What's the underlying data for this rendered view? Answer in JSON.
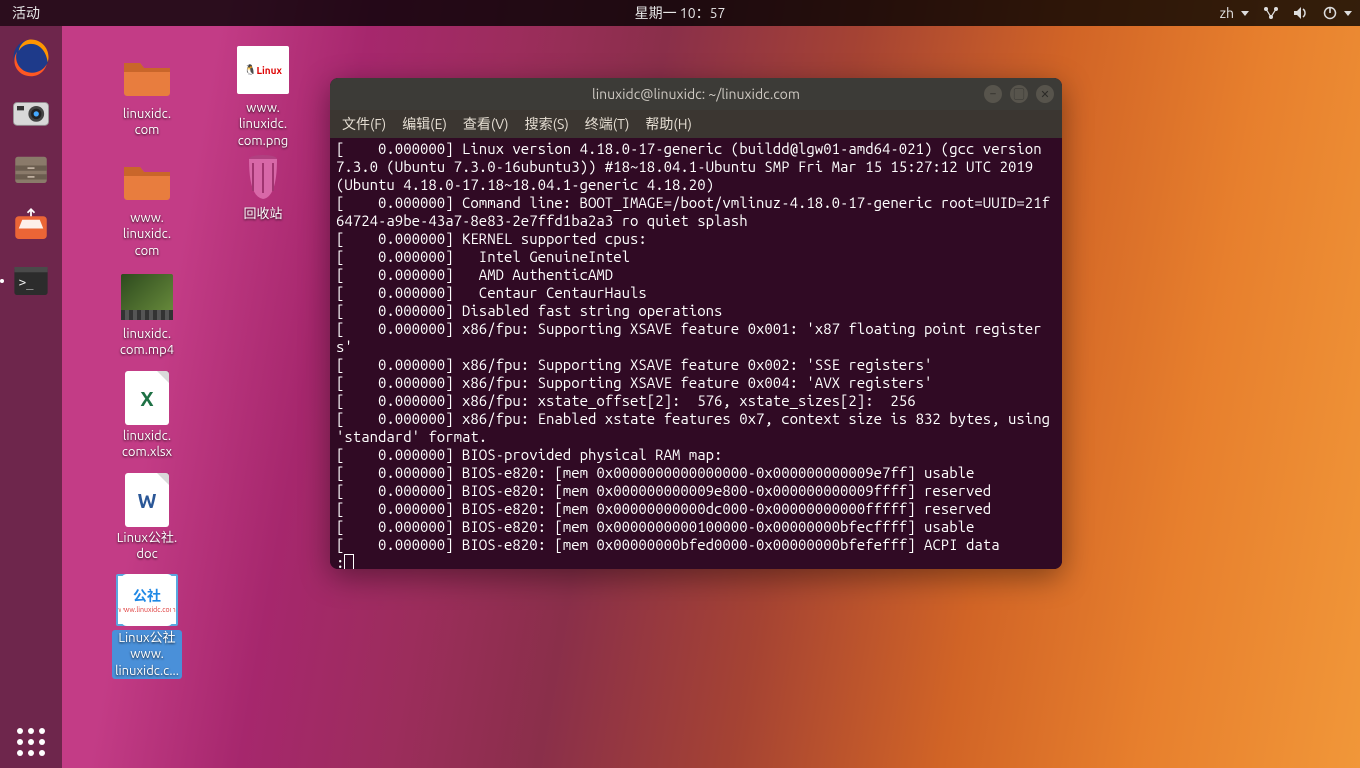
{
  "topbar": {
    "activities": "活动",
    "clock": "星期一 10：57",
    "ime": "zh"
  },
  "desktop_icons": {
    "folder1": "linuxidc.\ncom",
    "folder2": "www.\nlinuxidc.\ncom",
    "video": "linuxidc.\ncom.mp4",
    "xlsx": "linuxidc.\ncom.xlsx",
    "doc": "Linux公社.\ndoc",
    "pub": "Linux公社\nwww.\nlinuxidc.c...",
    "png": "www.\nlinuxidc.\ncom.png",
    "png_badge": "Linux",
    "trash": "回收站",
    "pub_text": "公社"
  },
  "terminal": {
    "title": "linuxidc@linuxidc: ~/linuxidc.com",
    "menus": {
      "file": "文件(F)",
      "edit": "编辑(E)",
      "view": "查看(V)",
      "search": "搜索(S)",
      "terminal": "终端(T)",
      "help": "帮助(H)"
    },
    "lines": [
      "[    0.000000] Linux version 4.18.0-17-generic (buildd@lgw01-amd64-021) (gcc version 7.3.0 (Ubuntu 7.3.0-16ubuntu3)) #18~18.04.1-Ubuntu SMP Fri Mar 15 15:27:12 UTC 2019 (Ubuntu 4.18.0-17.18~18.04.1-generic 4.18.20)",
      "[    0.000000] Command line: BOOT_IMAGE=/boot/vmlinuz-4.18.0-17-generic root=UUID=21f64724-a9be-43a7-8e83-2e7ffd1ba2a3 ro quiet splash",
      "[    0.000000] KERNEL supported cpus:",
      "[    0.000000]   Intel GenuineIntel",
      "[    0.000000]   AMD AuthenticAMD",
      "[    0.000000]   Centaur CentaurHauls",
      "[    0.000000] Disabled fast string operations",
      "[    0.000000] x86/fpu: Supporting XSAVE feature 0x001: 'x87 floating point registers'",
      "[    0.000000] x86/fpu: Supporting XSAVE feature 0x002: 'SSE registers'",
      "[    0.000000] x86/fpu: Supporting XSAVE feature 0x004: 'AVX registers'",
      "[    0.000000] x86/fpu: xstate_offset[2]:  576, xstate_sizes[2]:  256",
      "[    0.000000] x86/fpu: Enabled xstate features 0x7, context size is 832 bytes, using 'standard' format.",
      "[    0.000000] BIOS-provided physical RAM map:",
      "[    0.000000] BIOS-e820: [mem 0x0000000000000000-0x000000000009e7ff] usable",
      "[    0.000000] BIOS-e820: [mem 0x000000000009e800-0x000000000009ffff] reserved",
      "[    0.000000] BIOS-e820: [mem 0x00000000000dc000-0x00000000000fffff] reserved",
      "[    0.000000] BIOS-e820: [mem 0x0000000000100000-0x00000000bfecffff] usable",
      "[    0.000000] BIOS-e820: [mem 0x00000000bfed0000-0x00000000bfefefff] ACPI data"
    ],
    "prompt": ":"
  }
}
